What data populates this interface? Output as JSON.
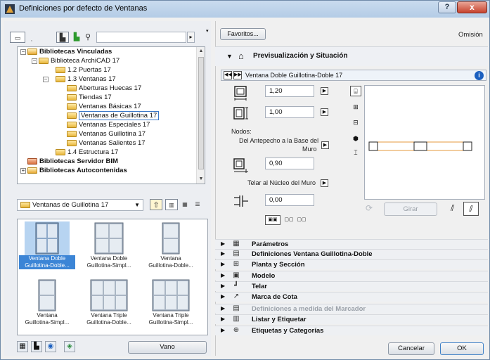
{
  "window": {
    "title": "Definiciones por defecto de Ventanas",
    "help_label": "?",
    "close_label": "x"
  },
  "left": {
    "tree": [
      {
        "label": "Bibliotecas Vinculadas",
        "bold": true,
        "kind": "lib"
      },
      {
        "label": "Biblioteca ArchiCAD 17",
        "bold": false,
        "kind": "folder"
      },
      {
        "label": "1.2 Puertas 17",
        "bold": false,
        "kind": "folder"
      },
      {
        "label": "1.3 Ventanas 17",
        "bold": false,
        "kind": "folder"
      },
      {
        "label": "Aberturas Huecas 17",
        "bold": false,
        "kind": "folder"
      },
      {
        "label": "Tiendas 17",
        "bold": false,
        "kind": "folder"
      },
      {
        "label": "Ventanas Básicas 17",
        "bold": false,
        "kind": "folder"
      },
      {
        "label": "Ventanas de Guillotina 17",
        "bold": false,
        "kind": "folder",
        "selected": true
      },
      {
        "label": "Ventanas Especiales 17",
        "bold": false,
        "kind": "folder"
      },
      {
        "label": "Ventanas Guillotina 17",
        "bold": false,
        "kind": "folder"
      },
      {
        "label": "Ventanas Salientes 17",
        "bold": false,
        "kind": "folder"
      },
      {
        "label": "1.4 Estructura 17",
        "bold": false,
        "kind": "folder"
      },
      {
        "label": "Bibliotecas Servidor BIM",
        "bold": true,
        "kind": "server"
      },
      {
        "label": "Bibliotecas Autocontenidas",
        "bold": true,
        "kind": "lib"
      }
    ],
    "combo_value": "Ventanas de Guillotina 17",
    "gallery": [
      {
        "line1": "Ventana Doble",
        "line2": "Guillotina-Doble...",
        "selected": true
      },
      {
        "line1": "Ventana Doble",
        "line2": "Guillotina-Simpl...",
        "selected": false
      },
      {
        "line1": "Ventana",
        "line2": "Guillotina-Doble...",
        "selected": false
      },
      {
        "line1": "Ventana",
        "line2": "Guillotina-Simpl...",
        "selected": false
      },
      {
        "line1": "Ventana Triple",
        "line2": "Guillotina-Doble...",
        "selected": false
      },
      {
        "line1": "Ventana Triple",
        "line2": "Guillotina-Simpl...",
        "selected": false
      }
    ],
    "vano_label": "Vano"
  },
  "right": {
    "favoritos_label": "Favoritos...",
    "omision_label": "Omisión",
    "panel_title": "Previsualización y Situación",
    "element_name": "Ventana Doble Guillotina-Doble 17",
    "width_value": "1,20",
    "height_value": "1,00",
    "nodos_label": "Nodos:",
    "antepecho_line1": "Del Antepecho a la Base del",
    "antepecho_line2": "Muro",
    "antepecho_value": "0,90",
    "telar_label": "Telar al Núcleo del Muro",
    "offset_value": "0,00",
    "girar_label": "Girar",
    "sections": [
      {
        "label": "Parámetros",
        "icon": "parametros-icon",
        "glyph": "▦",
        "disabled": false
      },
      {
        "label": "Definiciones Ventana Guillotina-Doble",
        "icon": "definiciones-icon",
        "glyph": "▤",
        "disabled": false
      },
      {
        "label": "Planta y Sección",
        "icon": "planta-icon",
        "glyph": "⊞",
        "disabled": false
      },
      {
        "label": "Modelo",
        "icon": "modelo-icon",
        "glyph": "▣",
        "disabled": false
      },
      {
        "label": "Telar",
        "icon": "telar-icon",
        "glyph": "┛",
        "disabled": false
      },
      {
        "label": "Marca de Cota",
        "icon": "marca-cota-icon",
        "glyph": "↗",
        "disabled": false
      },
      {
        "label": "Definiciones a medida del Marcador",
        "icon": "marcador-icon",
        "glyph": "▤",
        "disabled": true
      },
      {
        "label": "Listar y Etiquetar",
        "icon": "listar-icon",
        "glyph": "▥",
        "disabled": false
      },
      {
        "label": "Etiquetas y Categorías",
        "icon": "etiquetas-icon",
        "glyph": "⊕",
        "disabled": false
      }
    ],
    "cancel_label": "Cancelar",
    "ok_label": "OK"
  }
}
